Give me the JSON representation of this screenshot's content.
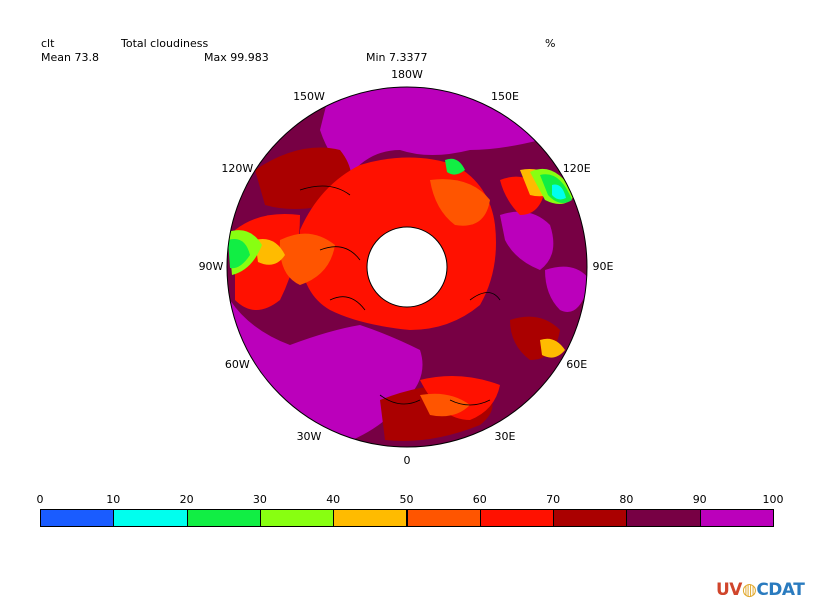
{
  "header": {
    "variable": "clt",
    "long_name": "Total cloudiness",
    "units": "%",
    "mean": "Mean 73.8",
    "max": "Max 99.983",
    "min": "Min 7.3377"
  },
  "longitude_labels": [
    {
      "text": "180W",
      "angle": 180
    },
    {
      "text": "150E",
      "angle": 150
    },
    {
      "text": "120E",
      "angle": 120
    },
    {
      "text": "90E",
      "angle": 90
    },
    {
      "text": "60E",
      "angle": 60
    },
    {
      "text": "30E",
      "angle": 30
    },
    {
      "text": "0",
      "angle": 0
    },
    {
      "text": "30W",
      "angle": -30
    },
    {
      "text": "60W",
      "angle": -60
    },
    {
      "text": "90W",
      "angle": -90
    },
    {
      "text": "120W",
      "angle": -120
    },
    {
      "text": "150W",
      "angle": -150
    }
  ],
  "colorbar": {
    "ticks": [
      "0",
      "10",
      "20",
      "30",
      "40",
      "50",
      "60",
      "70",
      "80",
      "90",
      "100"
    ],
    "colors": [
      "#1a5cff",
      "#00ffee",
      "#11ee44",
      "#88ff11",
      "#ffbb00",
      "#ff5500",
      "#ff1100",
      "#aa0000",
      "#770044",
      "#bb00bb"
    ]
  },
  "map_data": {
    "projection": "north polar stereographic",
    "field": "clt",
    "fill_colors": {
      "v90_100": "#bb00bb",
      "v80_90": "#770044",
      "v70_80": "#aa0000",
      "v60_70": "#ff1100",
      "v50_60": "#ff5500",
      "v40_50": "#ffbb00",
      "v30_40": "#88ff11",
      "v20_30": "#11ee44",
      "v10_20": "#00ffee"
    }
  },
  "logo": {
    "part1": "UV",
    "part2": "C",
    "part3": "DAT"
  }
}
